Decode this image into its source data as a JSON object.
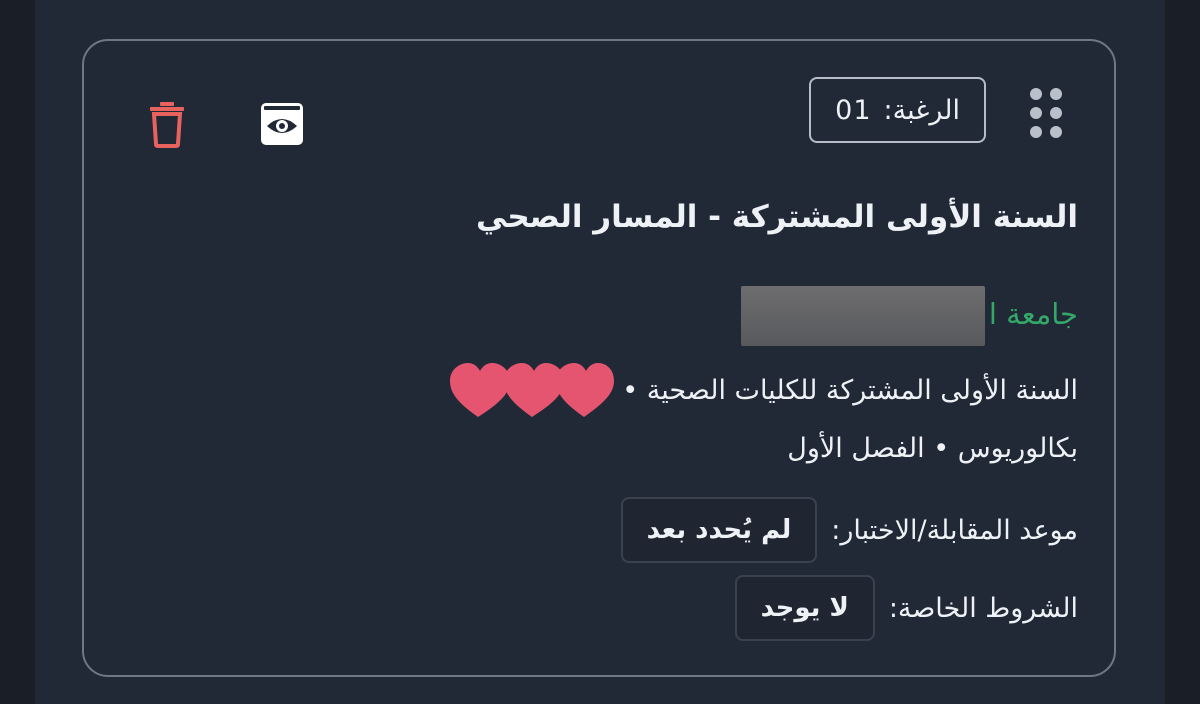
{
  "card": {
    "preference": {
      "label": "الرغبة:",
      "number": "01"
    },
    "icons": {
      "drag": "drag-handle-icon",
      "view": "eye-icon",
      "delete": "trash-icon"
    },
    "title": "السنة الأولى المشتركة - المسار الصحي",
    "university_prefix": "جامعة ا",
    "program_line": "السنة الأولى المشتركة للكليات الصحية •",
    "degree_line": "بكالوريوس • الفصل الأول",
    "interview": {
      "label": "موعد المقابلة/الاختبار:",
      "value": "لم يُحدد بعد"
    },
    "conditions": {
      "label": "الشروط الخاصة:",
      "value": "لا يوجد"
    }
  },
  "colors": {
    "background": "#212936",
    "border": "#6f7782",
    "university_text": "#33a869",
    "delete_icon": "#e8625e",
    "heart": "#e55570"
  }
}
